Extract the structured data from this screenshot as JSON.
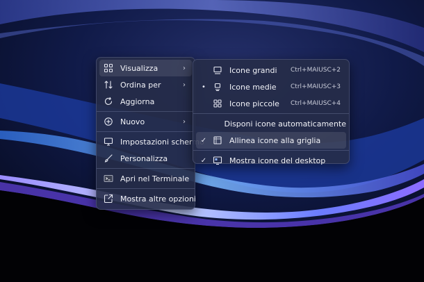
{
  "context_menu": {
    "items": [
      {
        "label": "Visualizza",
        "icon": "grid-icon"
      },
      {
        "label": "Ordina per",
        "icon": "sort-arrows-icon"
      },
      {
        "label": "Aggiorna",
        "icon": "refresh-icon"
      },
      {
        "label": "Nuovo",
        "icon": "plus-circle-icon"
      },
      {
        "label": "Impostazioni schermo",
        "icon": "monitor-settings-icon"
      },
      {
        "label": "Personalizza",
        "icon": "brush-icon"
      },
      {
        "label": "Apri nel Terminale",
        "icon": "terminal-icon"
      },
      {
        "label": "Mostra altre opzioni",
        "icon": "more-options-icon"
      }
    ]
  },
  "view_submenu": {
    "items": [
      {
        "label": "Icone grandi",
        "shortcut": "Ctrl+MAIUSC+2",
        "mark": ""
      },
      {
        "label": "Icone medie",
        "shortcut": "Ctrl+MAIUSC+3",
        "mark": "•"
      },
      {
        "label": "Icone piccole",
        "shortcut": "Ctrl+MAIUSC+4",
        "mark": ""
      },
      {
        "label": "Disponi icone automaticamente",
        "shortcut": "",
        "mark": ""
      },
      {
        "label": "Allinea icone alla griglia",
        "shortcut": "",
        "mark": "✓"
      },
      {
        "label": "Mostra icone del desktop",
        "shortcut": "",
        "mark": "✓"
      }
    ]
  },
  "colors": {
    "menu_bg": "#262c48",
    "text": "#f2f3f8",
    "accent_glow": "#7b5cff"
  }
}
